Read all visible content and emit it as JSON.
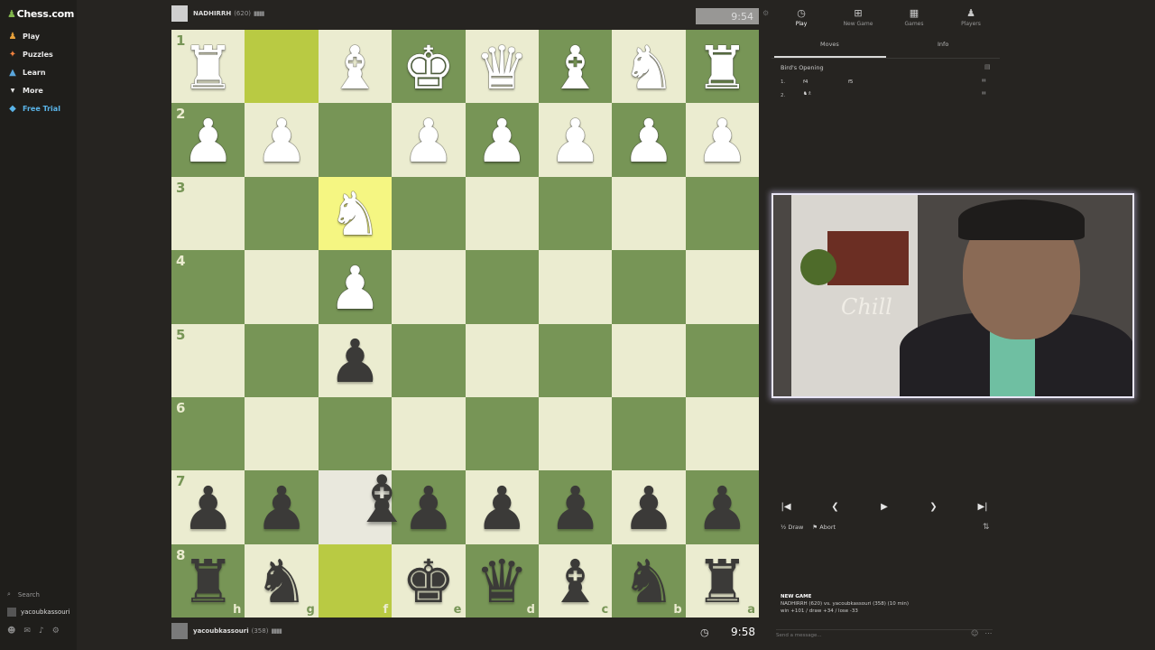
{
  "sidebar": {
    "logo": "Chess.com",
    "items": [
      {
        "label": "Play",
        "icon": "play-icon"
      },
      {
        "label": "Puzzles",
        "icon": "puzzle-icon"
      },
      {
        "label": "Learn",
        "icon": "learn-icon"
      },
      {
        "label": "More",
        "icon": "chevron-down-icon"
      },
      {
        "label": "Free Trial",
        "icon": "diamond-icon"
      }
    ],
    "search_label": "Search",
    "user": "yacoubkassouri"
  },
  "top_player": {
    "name": "NADHIRRH",
    "rating": "(620)",
    "clock": "9:54"
  },
  "bottom_player": {
    "name": "yacoubkassouri",
    "rating": "(358)",
    "clock": "9:58"
  },
  "board": {
    "orientation": "black",
    "ranks": [
      "1",
      "2",
      "3",
      "4",
      "5",
      "6",
      "7",
      "8"
    ],
    "files": [
      "h",
      "g",
      "f",
      "e",
      "d",
      "c",
      "b",
      "a"
    ]
  },
  "panel": {
    "tabs": [
      {
        "label": "Play",
        "icon": "clock-icon"
      },
      {
        "label": "New Game",
        "icon": "plus-icon"
      },
      {
        "label": "Games",
        "icon": "board-icon"
      },
      {
        "label": "Players",
        "icon": "players-icon"
      }
    ],
    "subtabs": [
      "Moves",
      "Info"
    ],
    "opening": "Bird's Opening",
    "moves": [
      {
        "num": "1.",
        "white": "f4",
        "black": "f5"
      },
      {
        "num": "2.",
        "white": "",
        "black": ""
      }
    ],
    "actions": [
      "Draw",
      "Abort"
    ],
    "new_game": {
      "heading": "NEW GAME",
      "line1": "NADHIRRH (620) vs. yacoubkassouri (358) (10 min)",
      "line2": "win +101 / draw +34 / lose -33"
    },
    "chat_placeholder": "Send a message..."
  },
  "webcam": {
    "sign_text": "Chill"
  },
  "colors": {
    "light_square": "#ebecd0",
    "dark_square": "#779556",
    "highlight_light": "#f5f682",
    "highlight_dark": "#b9ca43",
    "background": "#262421"
  }
}
